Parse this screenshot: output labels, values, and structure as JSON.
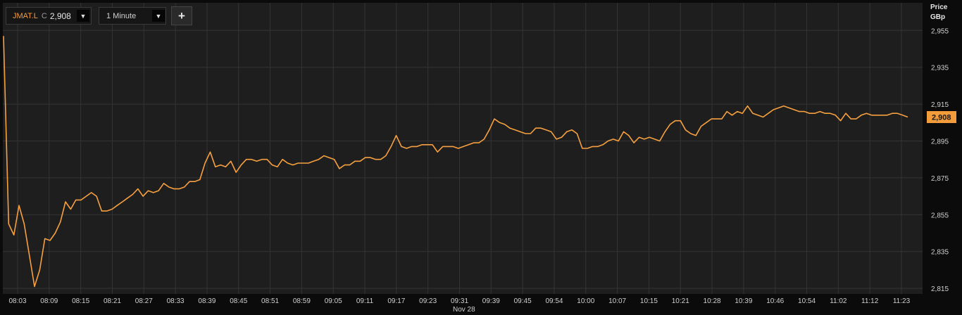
{
  "toolbar": {
    "symbol": "JMAT.L",
    "close_prefix": "C",
    "last_value": "2,908",
    "interval": "1 Minute",
    "add_label": "+",
    "dropdown_icon": "triangle-down-icon"
  },
  "price_axis": {
    "label": "Price",
    "unit": "GBp",
    "current_price_label": "2,908"
  },
  "colors": {
    "background": "#1e1e1e",
    "line": "#f7a040",
    "grid": "#343434",
    "price_tag": "#f39c3c"
  },
  "chart_data": {
    "type": "line",
    "date_label": "Nov 28",
    "x_tick_labels": [
      "08:03",
      "08:09",
      "08:15",
      "08:21",
      "08:27",
      "08:33",
      "08:39",
      "08:45",
      "08:51",
      "08:59",
      "09:05",
      "09:11",
      "09:17",
      "09:23",
      "09:31",
      "09:39",
      "09:45",
      "09:54",
      "10:00",
      "10:07",
      "10:15",
      "10:21",
      "10:28",
      "10:39",
      "10:46",
      "10:54",
      "11:02",
      "11:12",
      "11:23"
    ],
    "y_tick_labels": [
      "2,955",
      "2,935",
      "2,915",
      "2,895",
      "2,875",
      "2,855",
      "2,835",
      "2,815"
    ],
    "y_ticks": [
      2955,
      2935,
      2915,
      2895,
      2875,
      2855,
      2835,
      2815
    ],
    "ylim": [
      2812,
      2970
    ],
    "series": [
      {
        "values": [
          2952,
          2850,
          2844,
          2860,
          2850,
          2833,
          2816,
          2825,
          2842,
          2841,
          2845,
          2851,
          2862,
          2858,
          2863,
          2863,
          2865,
          2867,
          2865,
          2857,
          2857,
          2858,
          2860,
          2862,
          2864,
          2866,
          2869,
          2865,
          2868,
          2867,
          2868,
          2872,
          2870,
          2869,
          2869,
          2870,
          2873,
          2873,
          2874,
          2883,
          2889,
          2881,
          2882,
          2881,
          2884,
          2878,
          2882,
          2885,
          2885,
          2884,
          2885,
          2885,
          2882,
          2881,
          2885,
          2883,
          2882,
          2883,
          2883,
          2883,
          2884,
          2885,
          2887,
          2886,
          2885,
          2880,
          2882,
          2882,
          2884,
          2884,
          2886,
          2886,
          2885,
          2885,
          2887,
          2892,
          2898,
          2892,
          2891,
          2892,
          2892,
          2893,
          2893,
          2893,
          2889,
          2892,
          2892,
          2892,
          2891,
          2892,
          2893,
          2894,
          2894,
          2896,
          2901,
          2907,
          2905,
          2904,
          2902,
          2901,
          2900,
          2899,
          2899,
          2902,
          2902,
          2901,
          2900,
          2896,
          2897,
          2900,
          2901,
          2899,
          2891,
          2891,
          2892,
          2892,
          2893,
          2895,
          2896,
          2895,
          2900,
          2898,
          2894,
          2897,
          2896,
          2897,
          2896,
          2895,
          2900,
          2904,
          2906,
          2906,
          2901,
          2899,
          2898,
          2903,
          2905,
          2907,
          2907,
          2907,
          2911,
          2909,
          2911,
          2910,
          2914,
          2910,
          2909,
          2908,
          2910,
          2912,
          2913,
          2914,
          2913,
          2912,
          2911,
          2911,
          2910,
          2910,
          2911,
          2910,
          2910,
          2909,
          2906,
          2910,
          2907,
          2907,
          2909,
          2910,
          2909,
          2909,
          2909,
          2909,
          2910,
          2910,
          2909,
          2908
        ]
      }
    ],
    "grid": true,
    "last_value": 2908
  }
}
